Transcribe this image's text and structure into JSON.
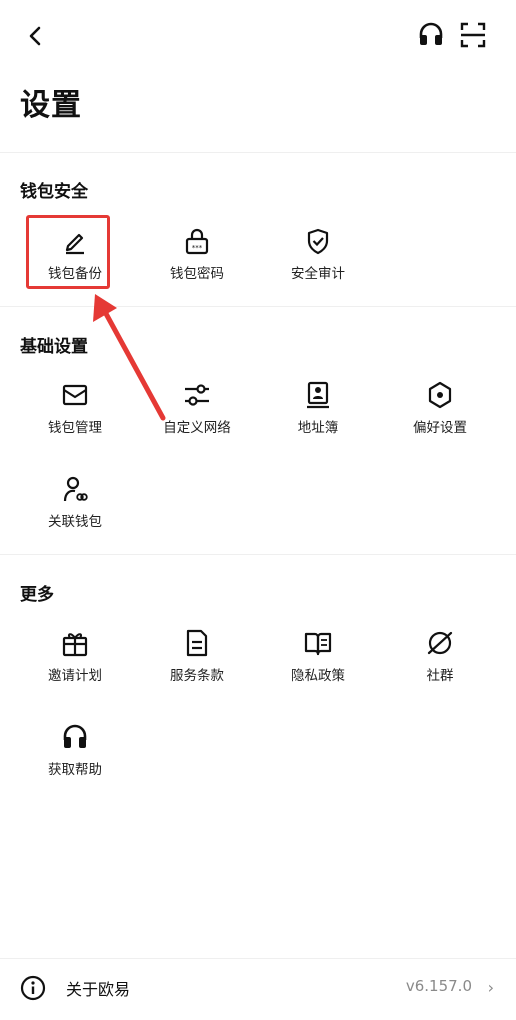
{
  "header": {
    "title": "设置",
    "back_icon": "chevron-left-icon",
    "support_icon": "headset-icon",
    "scan_icon": "scan-icon"
  },
  "sections": [
    {
      "title": "钱包安全",
      "items": [
        {
          "label": "钱包备份",
          "icon": "pencil-icon"
        },
        {
          "label": "钱包密码",
          "icon": "lock-password-icon"
        },
        {
          "label": "安全审计",
          "icon": "shield-check-icon"
        }
      ]
    },
    {
      "title": "基础设置",
      "items": [
        {
          "label": "钱包管理",
          "icon": "wallet-icon"
        },
        {
          "label": "自定义网络",
          "icon": "sliders-icon"
        },
        {
          "label": "地址簿",
          "icon": "contact-book-icon"
        },
        {
          "label": "偏好设置",
          "icon": "hexagon-settings-icon"
        },
        {
          "label": "关联钱包",
          "icon": "linked-user-icon"
        }
      ]
    },
    {
      "title": "更多",
      "items": [
        {
          "label": "邀请计划",
          "icon": "gift-icon"
        },
        {
          "label": "服务条款",
          "icon": "document-icon"
        },
        {
          "label": "隐私政策",
          "icon": "open-book-icon"
        },
        {
          "label": "社群",
          "icon": "planet-icon"
        },
        {
          "label": "获取帮助",
          "icon": "headset-icon"
        }
      ]
    }
  ],
  "footer": {
    "about_label": "关于欧易",
    "version": "v6.157.0",
    "info_icon": "info-icon",
    "chevron_icon": "chevron-right-icon"
  },
  "annotation": {
    "highlight_color": "#e53935"
  }
}
